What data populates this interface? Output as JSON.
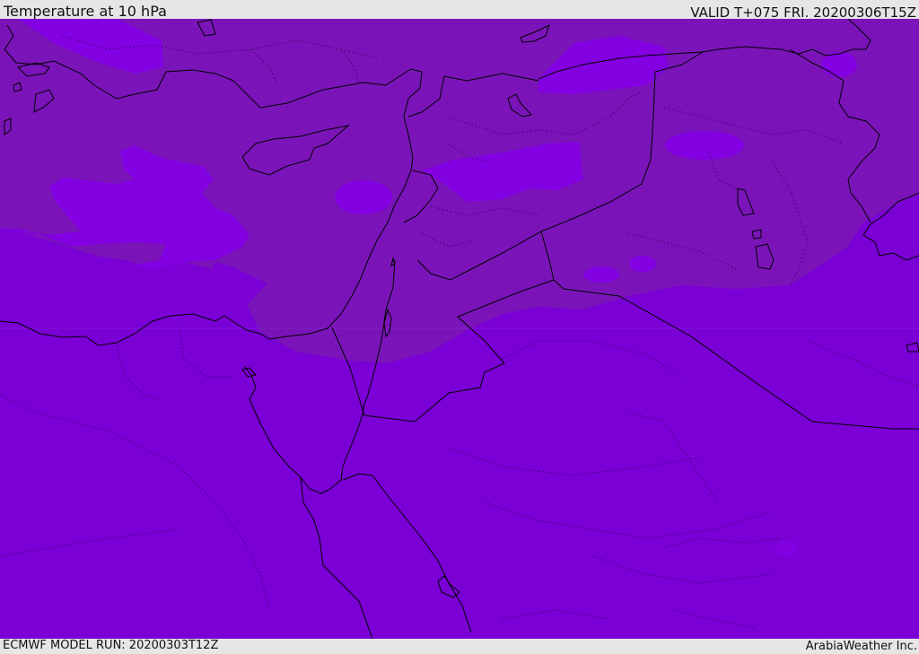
{
  "header": {
    "title": "Temperature at 10 hPa",
    "valid": "VALID T+075 FRI. 20200306T15Z"
  },
  "footer": {
    "model_run": "ECMWF MODEL RUN: 20200303T12Z",
    "credit": "ArabiaWeather Inc."
  },
  "colors": {
    "background_field": "#7a00d6",
    "warmer_field": "#7a14b8",
    "cooler_patch": "#8200e2",
    "coastline": "#000000",
    "border": "#000000",
    "admin_boundary": "#2a0050"
  }
}
